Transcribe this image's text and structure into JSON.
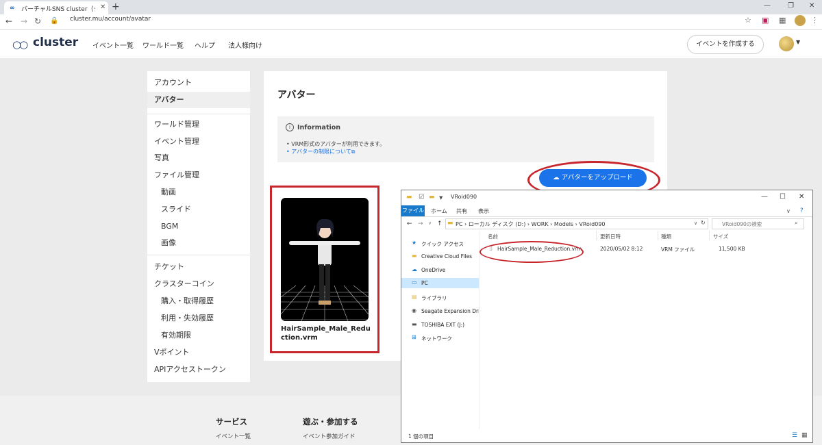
{
  "browser": {
    "tab_title": "バーチャルSNS cluster（クラスター）",
    "url": "cluster.mu/account/avatar"
  },
  "header": {
    "logo": "cluster",
    "nav": [
      "イベント一覧",
      "ワールド一覧",
      "ヘルプ",
      "法人様向け"
    ],
    "create_event": "イベントを作成する"
  },
  "sidebar": {
    "items": [
      "アカウント",
      "アバター",
      "ワールド管理",
      "イベント管理",
      "写真",
      "ファイル管理",
      "動画",
      "スライド",
      "BGM",
      "画像",
      "チケット",
      "クラスターコイン",
      "購入・取得履歴",
      "利用・失効履歴",
      "有効期限",
      "Vポイント",
      "APIアクセストークン"
    ]
  },
  "main": {
    "title": "アバター",
    "info_title": "Information",
    "info_line1": "• VRM形式のアバターが利用できます。",
    "info_line2": "• アバターの制限について",
    "upload_label": "アバターをアップロード",
    "avatar_name": "HairSample_Male_Reduction.vrm"
  },
  "footer": {
    "col1_head": "サービス",
    "col1_link": "イベント一覧",
    "col2_head": "遊ぶ・参加する",
    "col2_link": "イベント参加ガイド"
  },
  "explorer": {
    "title": "VRoid090",
    "ribbon": [
      "ファイル",
      "ホーム",
      "共有",
      "表示"
    ],
    "path": "PC  ›  ローカル ディスク (D:)  ›  WORK  ›  Models  ›  VRoid090",
    "search_placeholder": "VRoid090の検索",
    "nav": [
      "クイック アクセス",
      "Creative Cloud Files",
      "OneDrive",
      "PC",
      "ライブラリ",
      "Seagate Expansion Drive (",
      "TOSHIBA EXT (J:)",
      "ネットワーク"
    ],
    "columns": [
      "名前",
      "更新日時",
      "種類",
      "サイズ"
    ],
    "file": {
      "name": "HairSample_Male_Reduction.vrm",
      "modified": "2020/05/02 8:12",
      "type": "VRM ファイル",
      "size": "11,500 KB"
    },
    "status": "1 個の項目"
  }
}
